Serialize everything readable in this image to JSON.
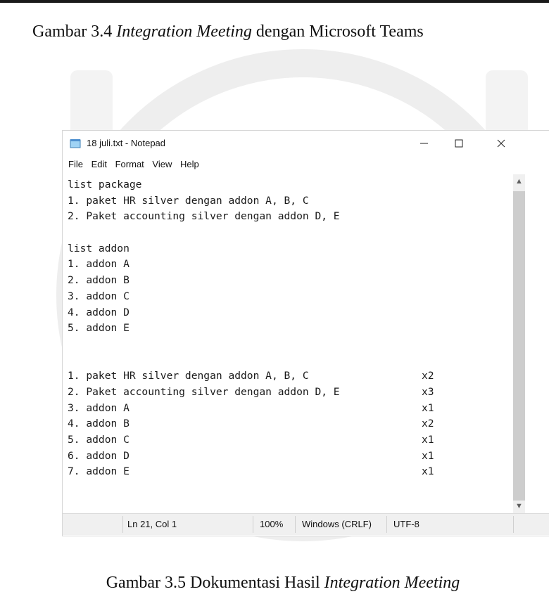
{
  "captions": {
    "top": {
      "prefix": "Gambar 3.4 ",
      "italic": "Integration Meeting",
      "suffix": " dengan Microsoft Teams"
    },
    "bottom": {
      "prefix": "Gambar 3.5 Dokumentasi Hasil ",
      "italic": "Integration Meeting",
      "suffix": ""
    }
  },
  "notepad": {
    "title": "18 juli.txt - Notepad",
    "window_buttons": {
      "minimize": "—",
      "maximize": "☐",
      "close": "✕"
    },
    "menu": [
      "File",
      "Edit",
      "Format",
      "View",
      "Help"
    ],
    "lines": [
      {
        "text": "list package",
        "qty": ""
      },
      {
        "text": "1. paket HR silver dengan addon A, B, C",
        "qty": ""
      },
      {
        "text": "2. Paket accounting silver dengan addon D, E",
        "qty": ""
      },
      {
        "text": "",
        "qty": ""
      },
      {
        "text": "list addon",
        "qty": ""
      },
      {
        "text": "1. addon A",
        "qty": ""
      },
      {
        "text": "2. addon B",
        "qty": ""
      },
      {
        "text": "3. addon C",
        "qty": ""
      },
      {
        "text": "4. addon D",
        "qty": ""
      },
      {
        "text": "5. addon E",
        "qty": ""
      },
      {
        "text": "",
        "qty": ""
      },
      {
        "text": "",
        "qty": ""
      },
      {
        "text": "1. paket HR silver dengan addon A, B, C",
        "qty": "x2"
      },
      {
        "text": "2. Paket accounting silver dengan addon D, E",
        "qty": "x3"
      },
      {
        "text": "3. addon A",
        "qty": "x1"
      },
      {
        "text": "4. addon B",
        "qty": "x2"
      },
      {
        "text": "5. addon C",
        "qty": "x1"
      },
      {
        "text": "6. addon D",
        "qty": "x1"
      },
      {
        "text": "7. addon E",
        "qty": "x1"
      }
    ],
    "status": {
      "position": "Ln 21, Col 1",
      "zoom": "100%",
      "line_ending": "Windows (CRLF)",
      "encoding": "UTF-8"
    }
  },
  "colors": {
    "accent": "#1a1a1a",
    "statusbar_bg": "#f0f0f0",
    "scroll_thumb": "#cdcdcd"
  }
}
